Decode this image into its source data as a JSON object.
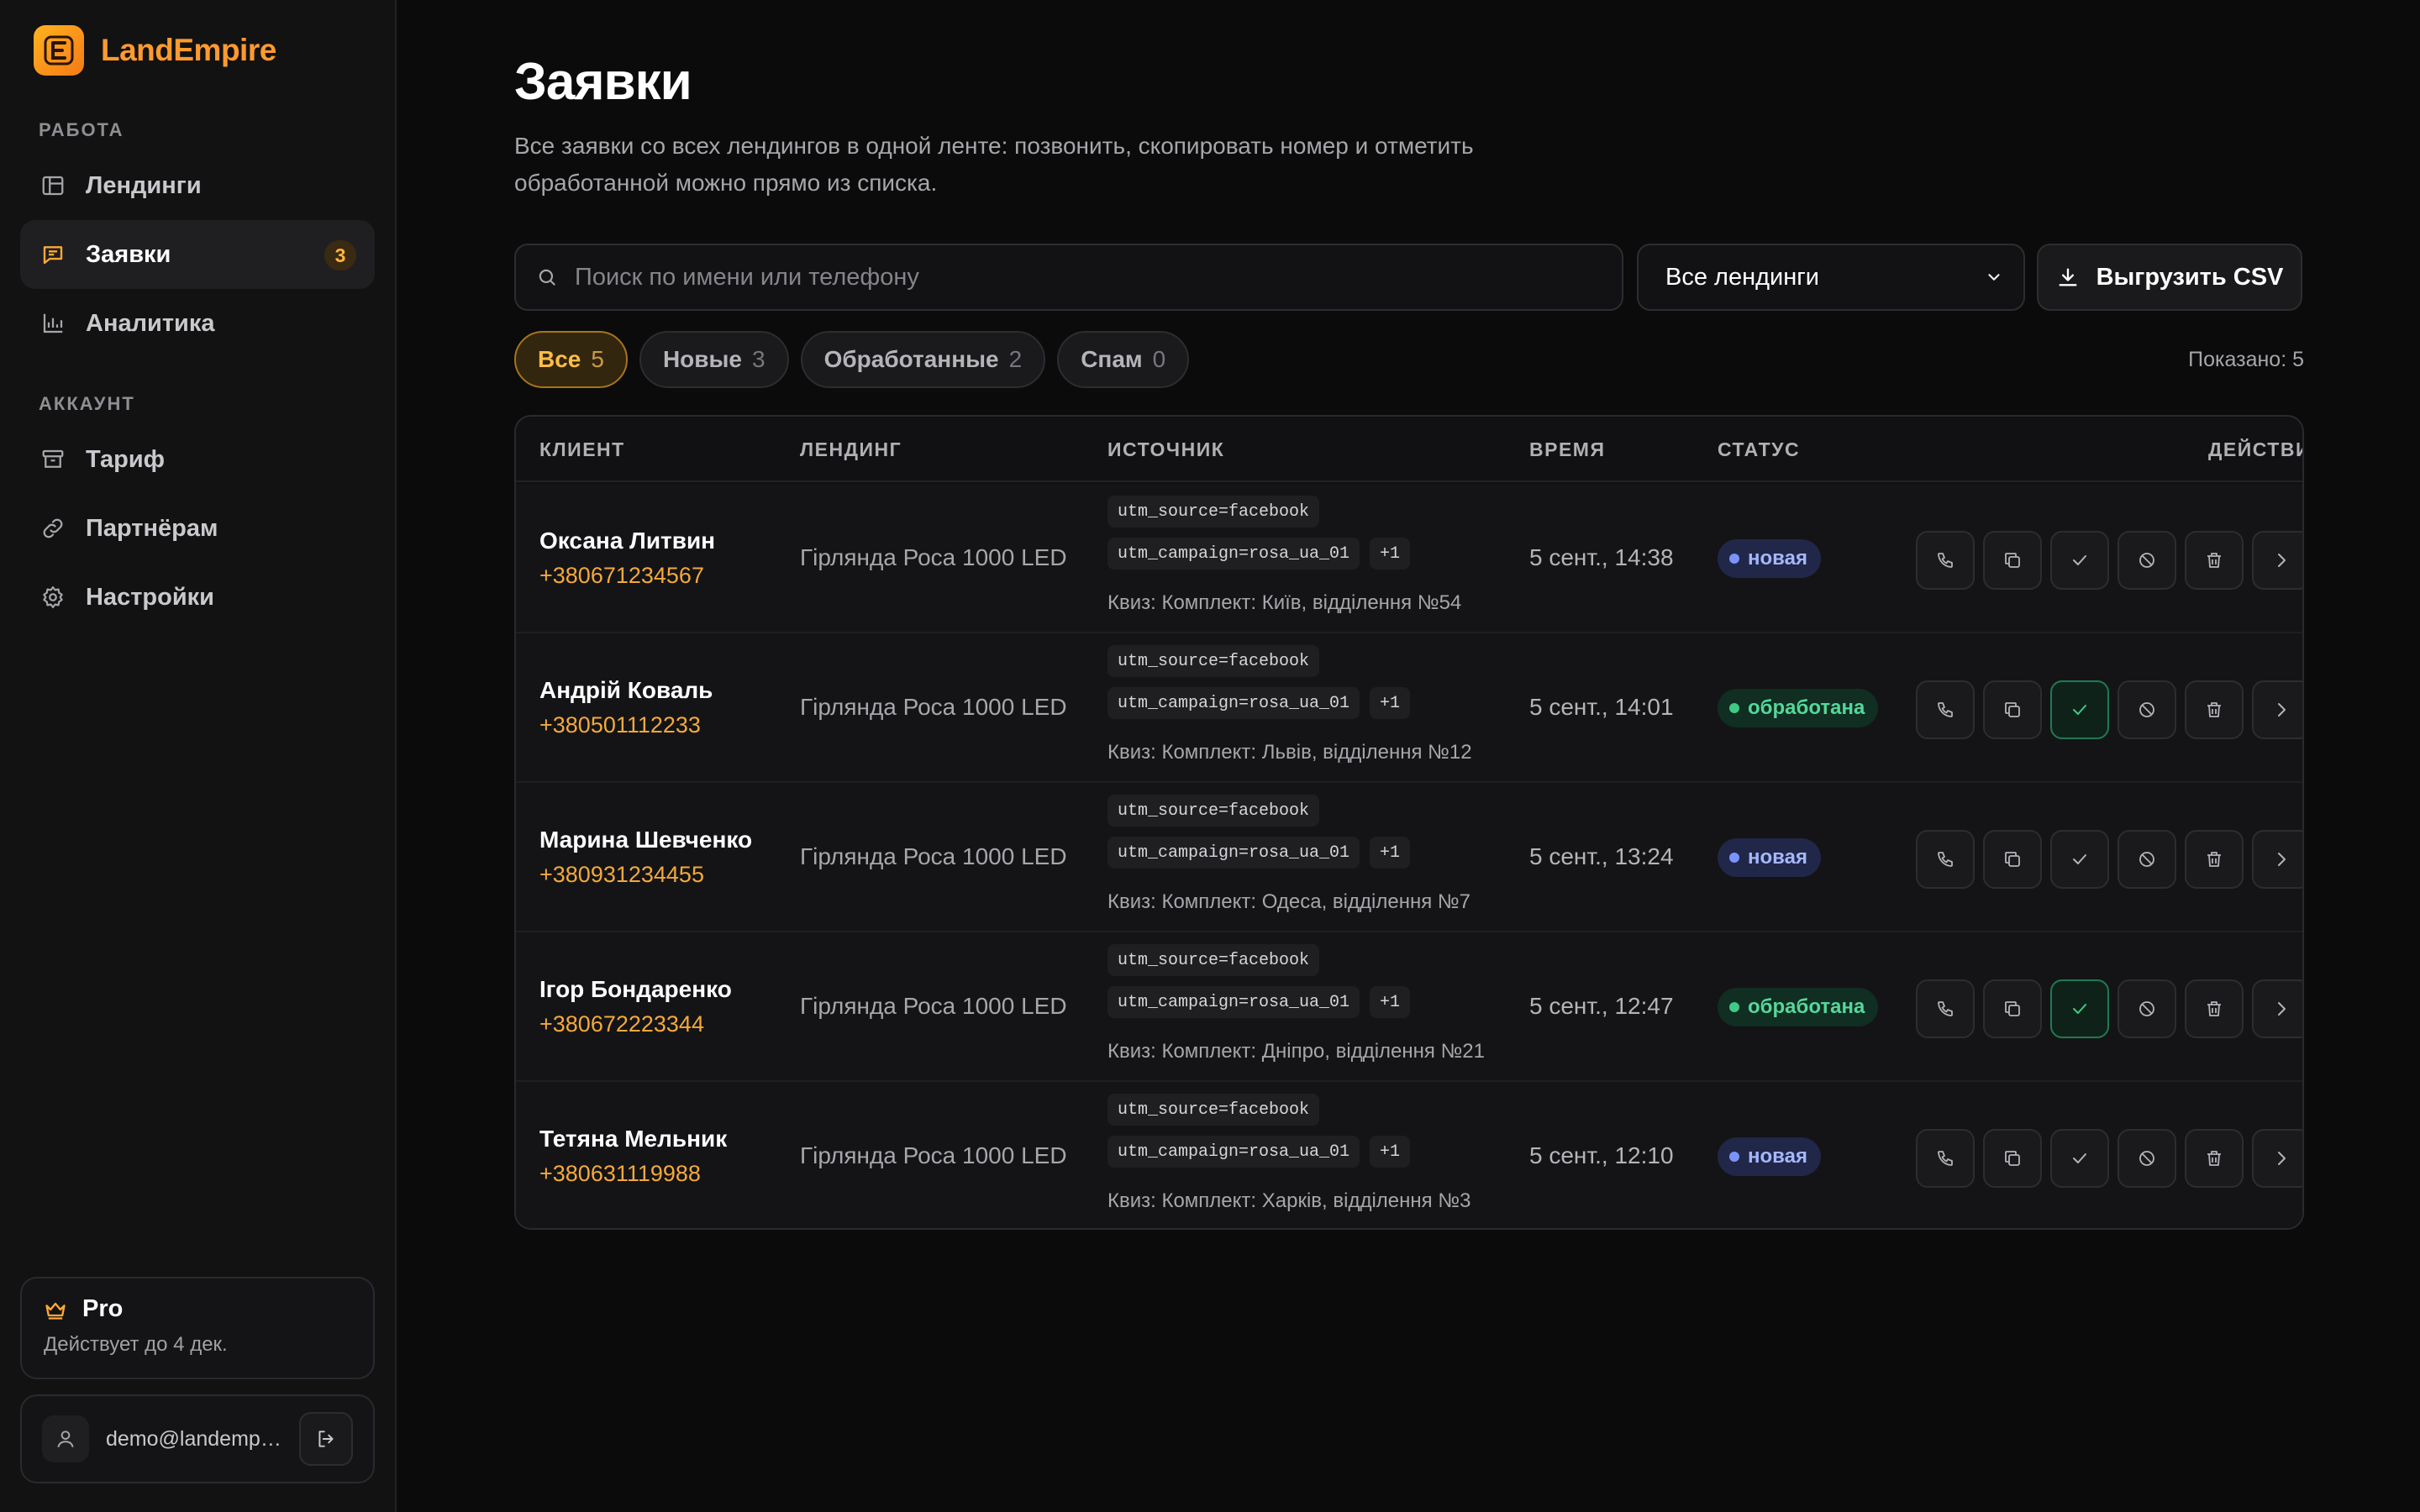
{
  "brand": {
    "name": "LandEmpire",
    "logo_letter": "E"
  },
  "sidebar": {
    "section_work": "РАБОТА",
    "section_account": "АККАУНТ",
    "work_items": [
      {
        "label": "Лендинги",
        "icon": "layout-icon"
      },
      {
        "label": "Заявки",
        "icon": "message-icon",
        "badge": "3",
        "active": true
      },
      {
        "label": "Аналитика",
        "icon": "bar-chart-icon"
      }
    ],
    "account_items": [
      {
        "label": "Тариф",
        "icon": "archive-icon"
      },
      {
        "label": "Партнёрам",
        "icon": "link-icon"
      },
      {
        "label": "Настройки",
        "icon": "gear-icon"
      }
    ],
    "plan": {
      "name": "Pro",
      "sub": "Действует до 4 дек."
    },
    "user": {
      "email": "demo@landempir..."
    }
  },
  "page": {
    "title": "Заявки",
    "description": "Все заявки со всех лендингов в одной ленте: позвонить, скопировать номер и отметить обработанной можно прямо из списка."
  },
  "toolbar": {
    "search_placeholder": "Поиск по имени или телефону",
    "landing_select": "Все лендинги",
    "export_label": "Выгрузить CSV"
  },
  "filters": [
    {
      "label": "Все",
      "count": "5",
      "active": true
    },
    {
      "label": "Новые",
      "count": "3"
    },
    {
      "label": "Обработанные",
      "count": "2"
    },
    {
      "label": "Спам",
      "count": "0"
    }
  ],
  "shown_text": "Показано: 5",
  "table": {
    "columns": [
      "КЛИЕНТ",
      "ЛЕНДИНГ",
      "ИСТОЧНИК",
      "ВРЕМЯ",
      "СТАТУС",
      "ДЕЙСТВИЯ"
    ],
    "rows": [
      {
        "name": "Оксана Литвин",
        "phone": "+380671234567",
        "landing": "Гірлянда Роса 1000 LED",
        "utm_source": "utm_source=facebook",
        "utm_campaign": "utm_campaign=rosa_ua_01",
        "more": "+1",
        "quiz": "Квиз: Комплект: Київ, відділення №54",
        "time": "5 сент., 14:38",
        "status": "новая",
        "status_type": "new"
      },
      {
        "name": "Андрій Коваль",
        "phone": "+380501112233",
        "landing": "Гірлянда Роса 1000 LED",
        "utm_source": "utm_source=facebook",
        "utm_campaign": "utm_campaign=rosa_ua_01",
        "more": "+1",
        "quiz": "Квиз: Комплект: Львів, відділення №12",
        "time": "5 сент., 14:01",
        "status": "обработана",
        "status_type": "done"
      },
      {
        "name": "Марина Шевченко",
        "phone": "+380931234455",
        "landing": "Гірлянда Роса 1000 LED",
        "utm_source": "utm_source=facebook",
        "utm_campaign": "utm_campaign=rosa_ua_01",
        "more": "+1",
        "quiz": "Квиз: Комплект: Одеса, відділення №7",
        "time": "5 сент., 13:24",
        "status": "новая",
        "status_type": "new"
      },
      {
        "name": "Ігор Бондаренко",
        "phone": "+380672223344",
        "landing": "Гірлянда Роса 1000 LED",
        "utm_source": "utm_source=facebook",
        "utm_campaign": "utm_campaign=rosa_ua_01",
        "more": "+1",
        "quiz": "Квиз: Комплект: Дніпро, відділення №21",
        "time": "5 сент., 12:47",
        "status": "обработана",
        "status_type": "done"
      },
      {
        "name": "Тетяна Мельник",
        "phone": "+380631119988",
        "landing": "Гірлянда Роса 1000 LED",
        "utm_source": "utm_source=facebook",
        "utm_campaign": "utm_campaign=rosa_ua_01",
        "more": "+1",
        "quiz": "Квиз: Комплект: Харків, відділення №3",
        "time": "5 сент., 12:10",
        "status": "новая",
        "status_type": "new"
      }
    ]
  },
  "colors": {
    "accent": "#ff9a2e",
    "phone": "#f4a93c",
    "status_new": "#7b93ff",
    "status_done": "#3fca86"
  }
}
